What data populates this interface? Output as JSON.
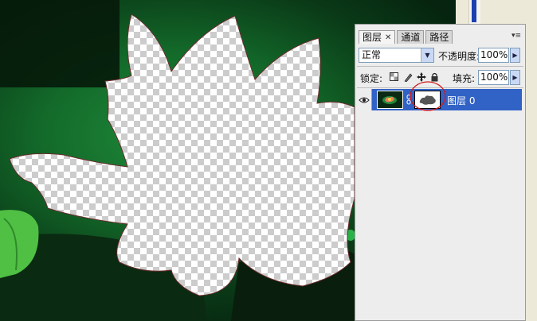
{
  "panel": {
    "tabs": [
      {
        "label": "图层",
        "active": true,
        "close_icon": "close-icon"
      },
      {
        "label": "通道",
        "active": false
      },
      {
        "label": "路径",
        "active": false
      }
    ],
    "menu_icon": "panel-menu-icon"
  },
  "blend_mode": {
    "value": "正常"
  },
  "opacity": {
    "label": "不透明度:",
    "value": "100%"
  },
  "lock": {
    "label": "锁定:",
    "icons": [
      "lock-transparency-icon",
      "lock-brush-icon",
      "lock-move-icon",
      "lock-all-icon"
    ]
  },
  "fill": {
    "label": "填充:",
    "value": "100%"
  },
  "layers": [
    {
      "name": "图层 0",
      "visible": true,
      "selected": true,
      "has_mask": true
    }
  ],
  "colors": {
    "selection": "#3162c5",
    "panel_bg": "#ededed",
    "mask_highlight": "#d21a1a"
  }
}
